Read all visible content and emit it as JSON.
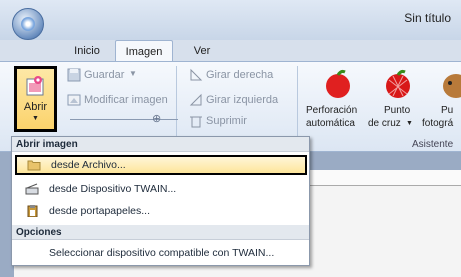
{
  "window": {
    "title": "Sin título"
  },
  "tabs": [
    {
      "label": "Inicio"
    },
    {
      "label": "Imagen"
    },
    {
      "label": "Ver"
    }
  ],
  "ribbon": {
    "abrir": {
      "label": "Abrir"
    },
    "guardar": "Guardar",
    "modificar": "Modificar imagen",
    "girar_derecha": "Girar derecha",
    "girar_izquierda": "Girar izquierda",
    "suprimir": "Suprimir",
    "perforacion": "Perforación",
    "automatica": "automática",
    "punto": "Punto",
    "de_cruz": "de cruz",
    "pu": "Pu",
    "fotogra": "fotográ",
    "group_asistente": "Asistente"
  },
  "menu": {
    "header_open": "Abrir imagen",
    "items": [
      {
        "label": "desde Archivo...",
        "icon": "folder-icon"
      },
      {
        "label": "desde Dispositivo TWAIN...",
        "icon": "scanner-icon"
      },
      {
        "label": "desde portapapeles...",
        "icon": "clipboard-icon"
      }
    ],
    "header_options": "Opciones",
    "option_item": "Seleccionar dispositivo compatible con TWAIN..."
  },
  "colors": {
    "highlight": "#fde59b",
    "ribbon": "#dce6f3"
  }
}
